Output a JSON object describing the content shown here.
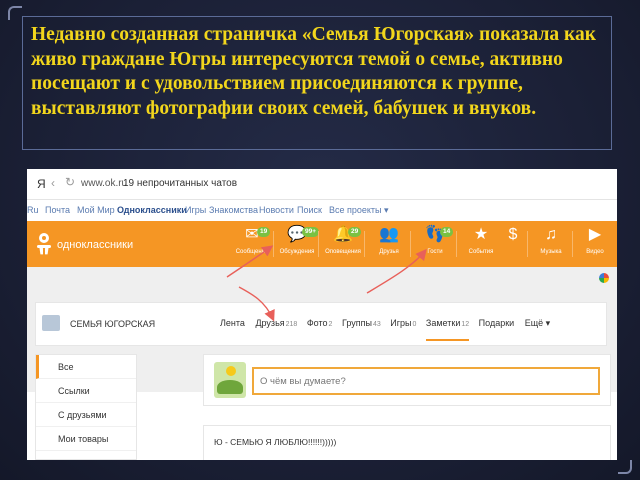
{
  "caption": "Недавно созданная страничка «Семья Югорская» показала как живо граждане Югры интересуются темой о семье, активно посещают и с удовольствием присоединяются к группе, выставляют фотографии своих семей, бабушек и внуков.",
  "browser": {
    "ya": "Я",
    "back": "‹",
    "reload": "↻",
    "url": "www.ok.ru",
    "title": "19 непрочитанных чатов"
  },
  "services": [
    "Ru",
    "Почта",
    "Мой Мир",
    "Одноклассники",
    "Игры",
    "Знакомства",
    "Новости",
    "Поиск",
    "Все проекты ▾"
  ],
  "site": {
    "name": "одноклассники",
    "nav": [
      {
        "label": "Сообщения",
        "icon": "envelope-icon",
        "glyph": "✉",
        "badge": "19"
      },
      {
        "label": "Обсуждения",
        "icon": "chat-bubble-icon",
        "glyph": "💬",
        "badge": "99+"
      },
      {
        "label": "Оповещения",
        "icon": "bell-icon",
        "glyph": "🔔",
        "badge": "29"
      },
      {
        "label": "Друзья",
        "icon": "friends-icon",
        "glyph": "👥",
        "badge": ""
      },
      {
        "label": "Гости",
        "icon": "footprints-icon",
        "glyph": "👣",
        "badge": "14"
      },
      {
        "label": "События",
        "icon": "events-icon",
        "glyph": "★",
        "badge": ""
      },
      {
        "label": "",
        "icon": "money-icon",
        "glyph": "$",
        "badge": ""
      },
      {
        "label": "Музыка",
        "icon": "music-icon",
        "glyph": "♫",
        "badge": ""
      },
      {
        "label": "Видео",
        "icon": "video-icon",
        "glyph": "▶",
        "badge": ""
      }
    ]
  },
  "group": {
    "title": "СЕМЬЯ ЮГОРСКАЯ",
    "tabs": [
      {
        "label": "Лента",
        "count": ""
      },
      {
        "label": "Друзья",
        "count": "218"
      },
      {
        "label": "Фото",
        "count": "2"
      },
      {
        "label": "Группы",
        "count": "43"
      },
      {
        "label": "Игры",
        "count": "0"
      },
      {
        "label": "Заметки",
        "count": "12"
      },
      {
        "label": "Подарки",
        "count": ""
      },
      {
        "label": "Ещё ▾",
        "count": ""
      }
    ]
  },
  "sidebar": [
    "Все",
    "Ссылки",
    "С друзьями",
    "Мои товары"
  ],
  "post_placeholder": "О чём вы думаете?",
  "feed_post": "Ю - СЕМЬЮ Я ЛЮБЛЮ!!!!!!)))))"
}
